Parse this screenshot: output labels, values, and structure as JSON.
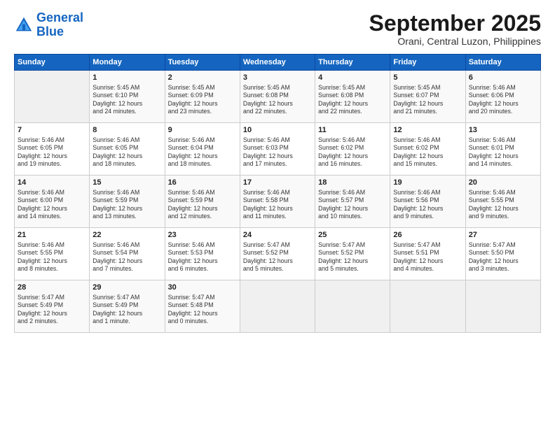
{
  "header": {
    "logo_line1": "General",
    "logo_line2": "Blue",
    "title": "September 2025",
    "location": "Orani, Central Luzon, Philippines"
  },
  "days_of_week": [
    "Sunday",
    "Monday",
    "Tuesday",
    "Wednesday",
    "Thursday",
    "Friday",
    "Saturday"
  ],
  "weeks": [
    [
      {
        "day": "",
        "info": ""
      },
      {
        "day": "1",
        "info": "Sunrise: 5:45 AM\nSunset: 6:10 PM\nDaylight: 12 hours\nand 24 minutes."
      },
      {
        "day": "2",
        "info": "Sunrise: 5:45 AM\nSunset: 6:09 PM\nDaylight: 12 hours\nand 23 minutes."
      },
      {
        "day": "3",
        "info": "Sunrise: 5:45 AM\nSunset: 6:08 PM\nDaylight: 12 hours\nand 22 minutes."
      },
      {
        "day": "4",
        "info": "Sunrise: 5:45 AM\nSunset: 6:08 PM\nDaylight: 12 hours\nand 22 minutes."
      },
      {
        "day": "5",
        "info": "Sunrise: 5:45 AM\nSunset: 6:07 PM\nDaylight: 12 hours\nand 21 minutes."
      },
      {
        "day": "6",
        "info": "Sunrise: 5:46 AM\nSunset: 6:06 PM\nDaylight: 12 hours\nand 20 minutes."
      }
    ],
    [
      {
        "day": "7",
        "info": "Sunrise: 5:46 AM\nSunset: 6:05 PM\nDaylight: 12 hours\nand 19 minutes."
      },
      {
        "day": "8",
        "info": "Sunrise: 5:46 AM\nSunset: 6:05 PM\nDaylight: 12 hours\nand 18 minutes."
      },
      {
        "day": "9",
        "info": "Sunrise: 5:46 AM\nSunset: 6:04 PM\nDaylight: 12 hours\nand 18 minutes."
      },
      {
        "day": "10",
        "info": "Sunrise: 5:46 AM\nSunset: 6:03 PM\nDaylight: 12 hours\nand 17 minutes."
      },
      {
        "day": "11",
        "info": "Sunrise: 5:46 AM\nSunset: 6:02 PM\nDaylight: 12 hours\nand 16 minutes."
      },
      {
        "day": "12",
        "info": "Sunrise: 5:46 AM\nSunset: 6:02 PM\nDaylight: 12 hours\nand 15 minutes."
      },
      {
        "day": "13",
        "info": "Sunrise: 5:46 AM\nSunset: 6:01 PM\nDaylight: 12 hours\nand 14 minutes."
      }
    ],
    [
      {
        "day": "14",
        "info": "Sunrise: 5:46 AM\nSunset: 6:00 PM\nDaylight: 12 hours\nand 14 minutes."
      },
      {
        "day": "15",
        "info": "Sunrise: 5:46 AM\nSunset: 5:59 PM\nDaylight: 12 hours\nand 13 minutes."
      },
      {
        "day": "16",
        "info": "Sunrise: 5:46 AM\nSunset: 5:59 PM\nDaylight: 12 hours\nand 12 minutes."
      },
      {
        "day": "17",
        "info": "Sunrise: 5:46 AM\nSunset: 5:58 PM\nDaylight: 12 hours\nand 11 minutes."
      },
      {
        "day": "18",
        "info": "Sunrise: 5:46 AM\nSunset: 5:57 PM\nDaylight: 12 hours\nand 10 minutes."
      },
      {
        "day": "19",
        "info": "Sunrise: 5:46 AM\nSunset: 5:56 PM\nDaylight: 12 hours\nand 9 minutes."
      },
      {
        "day": "20",
        "info": "Sunrise: 5:46 AM\nSunset: 5:55 PM\nDaylight: 12 hours\nand 9 minutes."
      }
    ],
    [
      {
        "day": "21",
        "info": "Sunrise: 5:46 AM\nSunset: 5:55 PM\nDaylight: 12 hours\nand 8 minutes."
      },
      {
        "day": "22",
        "info": "Sunrise: 5:46 AM\nSunset: 5:54 PM\nDaylight: 12 hours\nand 7 minutes."
      },
      {
        "day": "23",
        "info": "Sunrise: 5:46 AM\nSunset: 5:53 PM\nDaylight: 12 hours\nand 6 minutes."
      },
      {
        "day": "24",
        "info": "Sunrise: 5:47 AM\nSunset: 5:52 PM\nDaylight: 12 hours\nand 5 minutes."
      },
      {
        "day": "25",
        "info": "Sunrise: 5:47 AM\nSunset: 5:52 PM\nDaylight: 12 hours\nand 5 minutes."
      },
      {
        "day": "26",
        "info": "Sunrise: 5:47 AM\nSunset: 5:51 PM\nDaylight: 12 hours\nand 4 minutes."
      },
      {
        "day": "27",
        "info": "Sunrise: 5:47 AM\nSunset: 5:50 PM\nDaylight: 12 hours\nand 3 minutes."
      }
    ],
    [
      {
        "day": "28",
        "info": "Sunrise: 5:47 AM\nSunset: 5:49 PM\nDaylight: 12 hours\nand 2 minutes."
      },
      {
        "day": "29",
        "info": "Sunrise: 5:47 AM\nSunset: 5:49 PM\nDaylight: 12 hours\nand 1 minute."
      },
      {
        "day": "30",
        "info": "Sunrise: 5:47 AM\nSunset: 5:48 PM\nDaylight: 12 hours\nand 0 minutes."
      },
      {
        "day": "",
        "info": ""
      },
      {
        "day": "",
        "info": ""
      },
      {
        "day": "",
        "info": ""
      },
      {
        "day": "",
        "info": ""
      }
    ]
  ]
}
